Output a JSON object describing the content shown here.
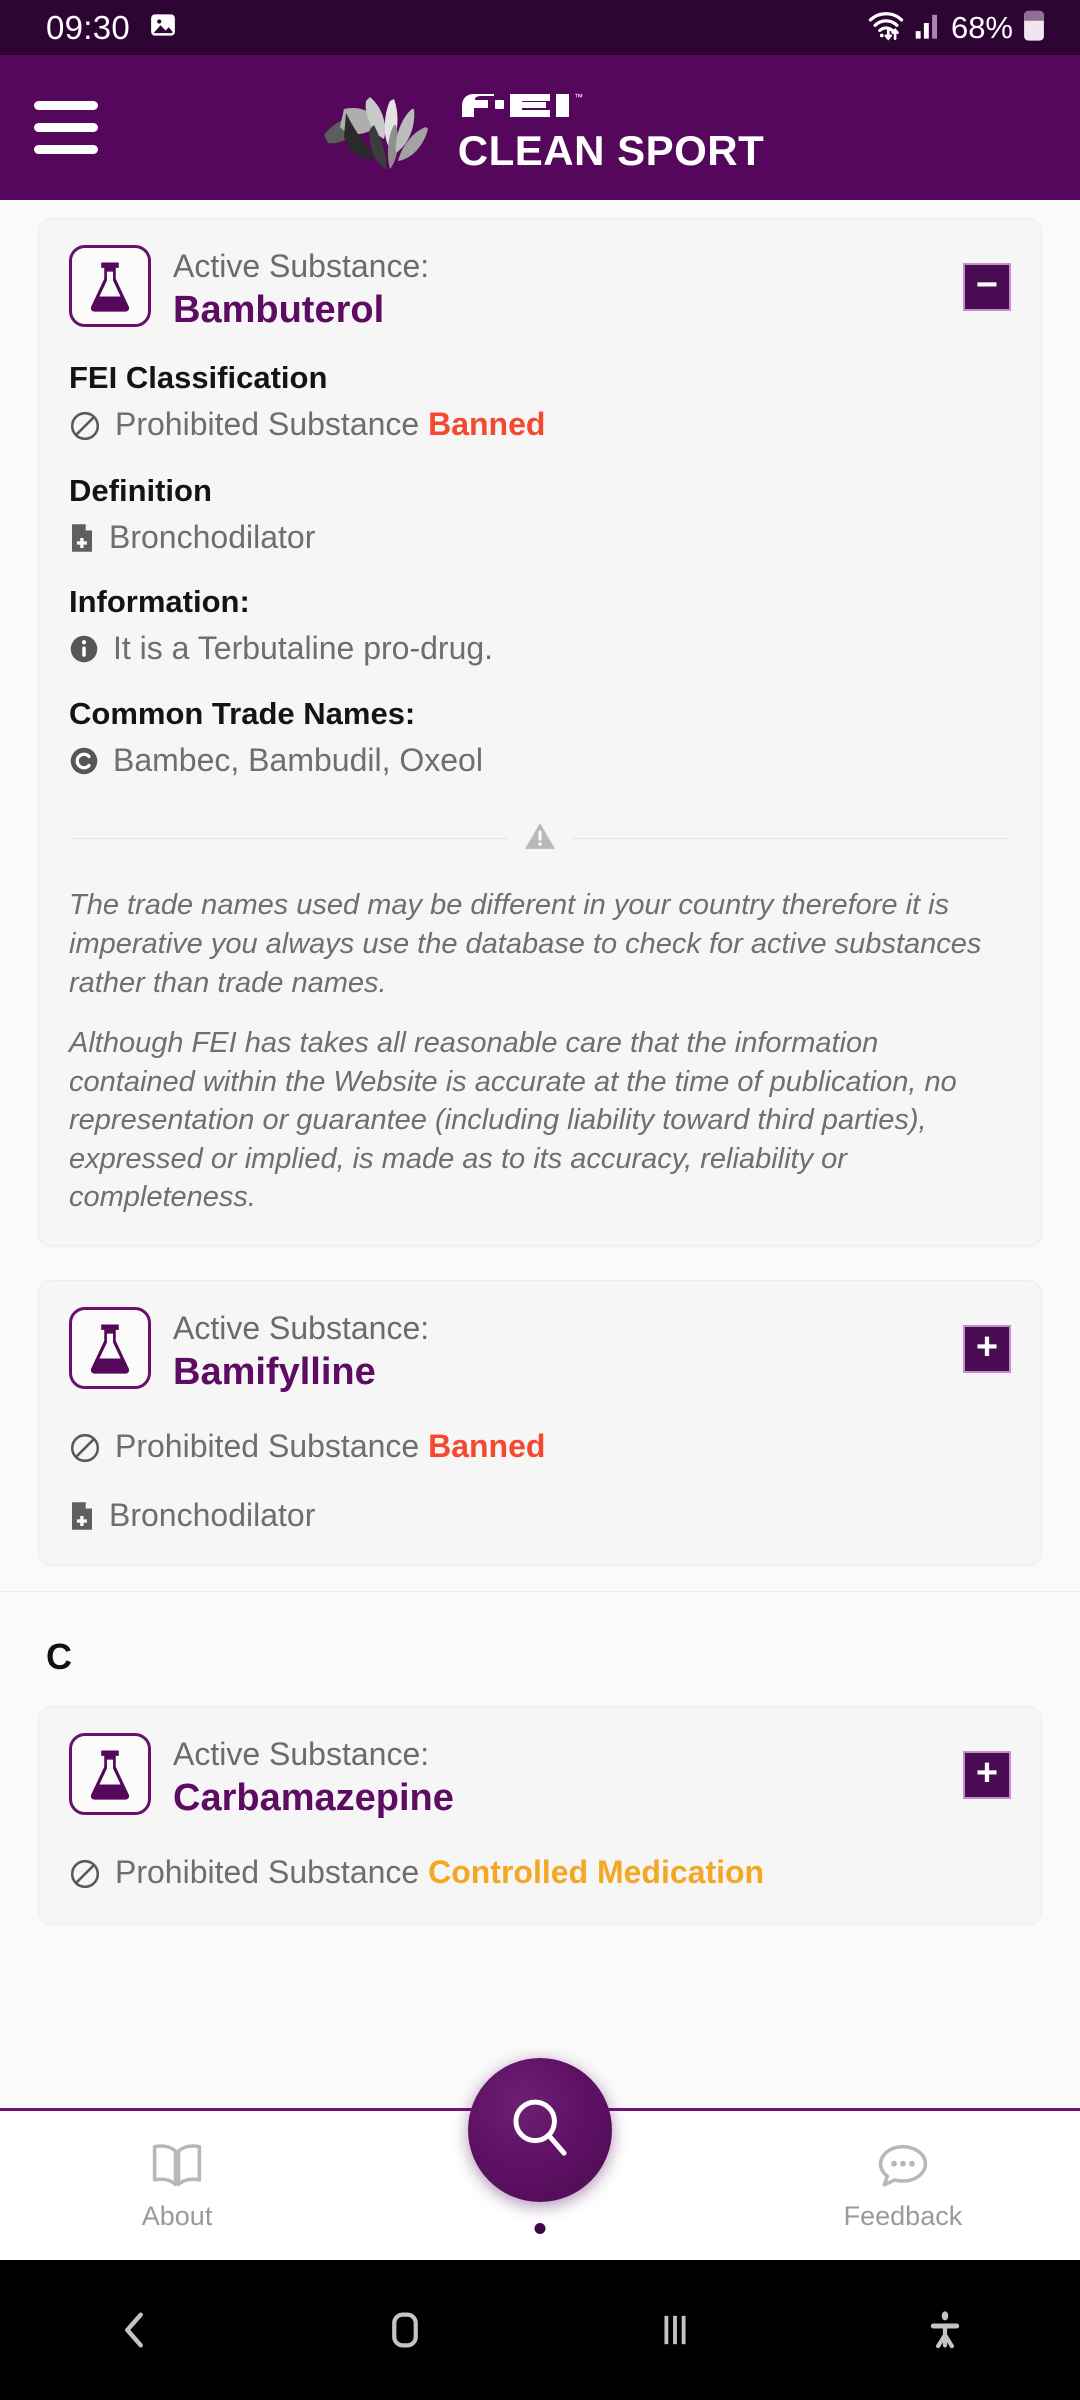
{
  "status_bar": {
    "clock": "09:30",
    "battery_percent": "68%",
    "icons": [
      "image-icon",
      "wifi-icon",
      "cellular-signal-icon",
      "battery-icon"
    ]
  },
  "header": {
    "menu_icon": "hamburger-menu-icon",
    "brand_line1": "FEI",
    "brand_line2": "CLEAN SPORT",
    "logo_icon": "fei-lotus-logo-icon",
    "background_color": "#55085b"
  },
  "labels": {
    "active_substance": "Active Substance:",
    "fei_classification": "FEI Classification",
    "definition": "Definition",
    "information": "Information:",
    "common_trade_names": "Common Trade Names:",
    "prohibited_substance": "Prohibited Substance"
  },
  "colors": {
    "brand_purple": "#55085b",
    "substance_purple": "#5d0b63",
    "banned_red": "#f4492f",
    "controlled_orange": "#f5a623"
  },
  "cards": [
    {
      "name": "Bambuterol",
      "expanded": true,
      "toggle_label": "−",
      "toggle_name": "collapse-button",
      "classification_text": "Prohibited Substance",
      "classification_tag": "Banned",
      "definition": "Bronchodilator",
      "information": "It is a Terbutaline pro-drug.",
      "trade_names": "Bambec, Bambudil, Oxeol"
    },
    {
      "name": "Bamifylline",
      "expanded": false,
      "toggle_label": "+",
      "toggle_name": "expand-button",
      "classification_text": "Prohibited Substance",
      "classification_tag": "Banned",
      "definition": "Bronchodilator"
    },
    {
      "name": "Carbamazepine",
      "expanded": false,
      "toggle_label": "+",
      "toggle_name": "expand-button",
      "classification_text": "Prohibited Substance",
      "classification_tag": "Controlled Medication"
    }
  ],
  "alpha_section_header": "C",
  "disclaimers": [
    "The trade names used may be different in your country therefore it is imperative you always use the database to check for active substances rather than trade names.",
    "Although FEI has takes all reasonable care that the information contained within the Website is accurate at the time of publication, no representation or guarantee (including liability toward third parties), expressed or implied, is made as to its accuracy, reliability or completeness."
  ],
  "bottom_nav": {
    "items": [
      {
        "label": "About",
        "icon": "book-icon"
      },
      {
        "label": "Feedback",
        "icon": "chat-bubble-icon"
      }
    ],
    "fab_icon": "search-icon"
  },
  "system_nav": {
    "back": "back-chevron-icon",
    "home": "home-icon",
    "recents": "recents-icon",
    "accessibility": "accessibility-icon"
  }
}
